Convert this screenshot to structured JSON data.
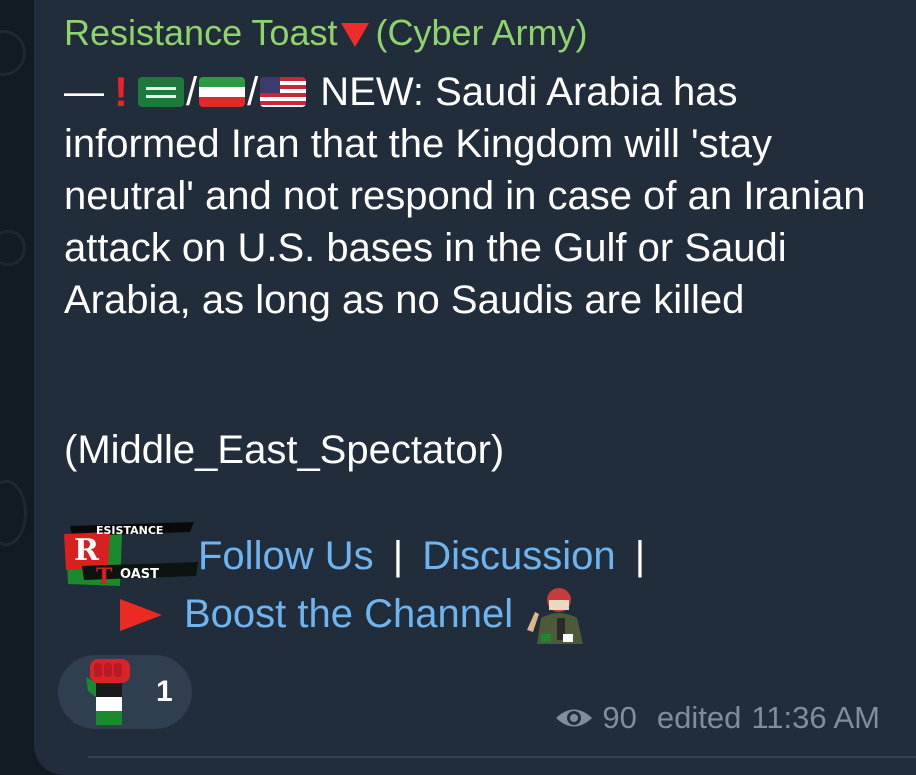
{
  "post": {
    "sender": "Resistance Toast",
    "sender_suffix": "(Cyber Army)",
    "lead_dash": "—",
    "flags": [
      "saudi-arabia-flag",
      "iran-flag",
      "usa-flag"
    ],
    "headline_start": "NEW: Saudi Arabia has",
    "body": "informed Iran that the Kingdom will 'stay neutral' and not respond in case of an Iranian attack on U.S. bases in the Gulf or Saudi Arabia, as long as no Saudis are killed",
    "source": "(Middle_East_Spectator)",
    "logo_text_top": "ESISTANCE",
    "logo_text_bottom": "OAST",
    "links": {
      "follow": "Follow Us",
      "separator": "|",
      "discussion": "Discussion",
      "boost": "Boost the Channel"
    }
  },
  "reaction": {
    "icon": "raised-fist-palestine-icon",
    "count": "1"
  },
  "meta": {
    "views": "90",
    "edited_label": "edited",
    "time": "11:36 AM"
  },
  "colors": {
    "bubble": "#212d3b",
    "background": "#121b23",
    "sender": "#8fd46b",
    "link": "#6eb4f0",
    "meta": "#7f8e9c"
  }
}
